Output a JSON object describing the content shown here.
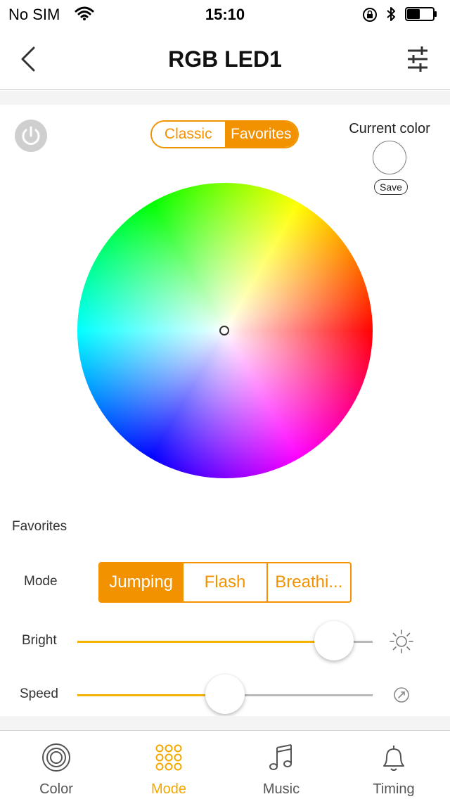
{
  "status_bar": {
    "carrier": "No SIM",
    "time": "15:10",
    "battery_level": 0.5
  },
  "nav": {
    "title": "RGB LED1"
  },
  "color_panel": {
    "tabs": [
      {
        "label": "Classic",
        "active": false
      },
      {
        "label": "Favorites",
        "active": true
      }
    ],
    "current_color_label": "Current color",
    "current_color_value": "#ffffff",
    "save_label": "Save"
  },
  "favorites_heading": "Favorites",
  "mode": {
    "label": "Mode",
    "options": [
      {
        "label": "Jumping",
        "active": true
      },
      {
        "label": "Flash",
        "active": false
      },
      {
        "label": "Breathi...",
        "active": false
      }
    ]
  },
  "bright": {
    "label": "Bright",
    "value": 0.87
  },
  "speed": {
    "label": "Speed",
    "value": 0.5
  },
  "tab_bar": {
    "tabs": [
      {
        "label": "Color",
        "icon": "concentric-circles-icon",
        "active": false
      },
      {
        "label": "Mode",
        "icon": "dot-grid-icon",
        "active": true
      },
      {
        "label": "Music",
        "icon": "music-note-icon",
        "active": false
      },
      {
        "label": "Timing",
        "icon": "bell-icon",
        "active": false
      }
    ]
  },
  "colors": {
    "accent": "#f39200",
    "slider_fill": "#f3b300",
    "tab_active": "#f3a800"
  }
}
